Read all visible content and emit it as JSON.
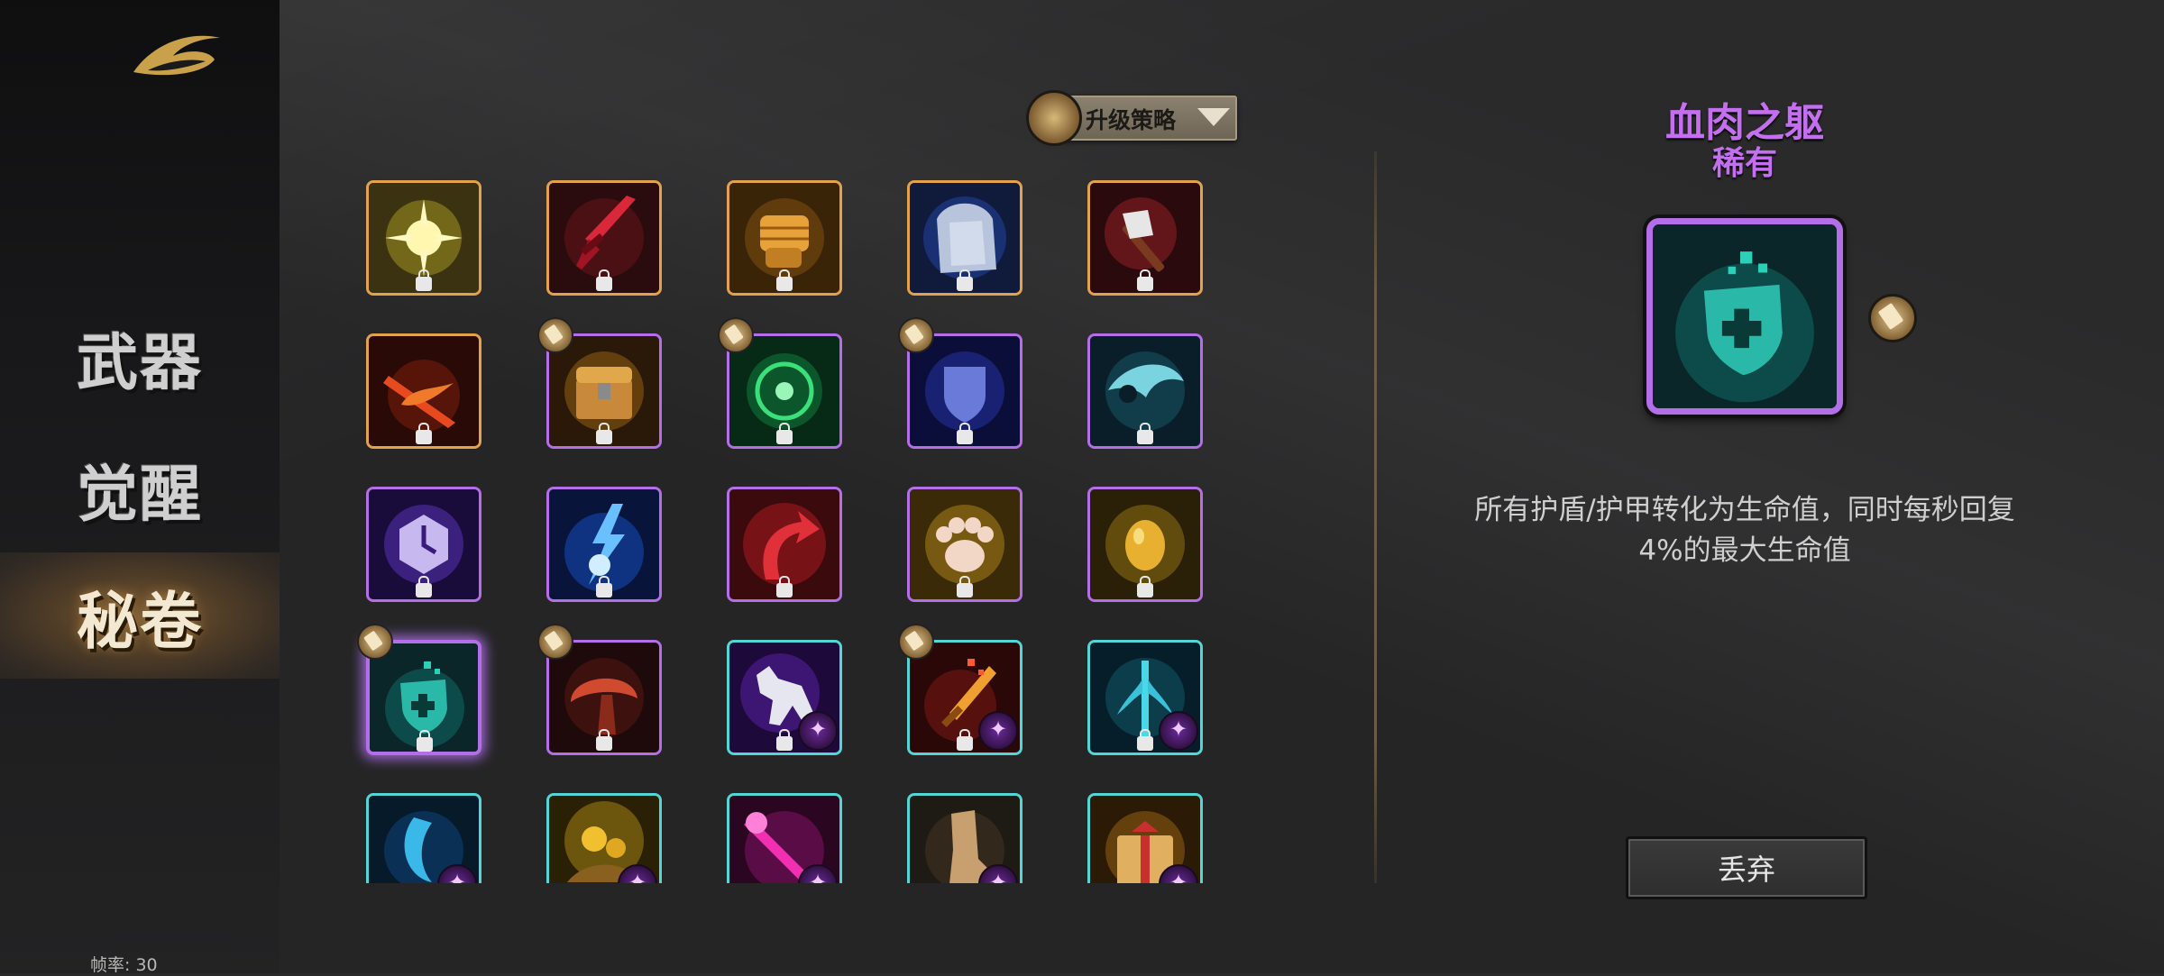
{
  "sidebar": {
    "logo_icon": "golden-swirl-logo-icon",
    "items": [
      {
        "label": "武器",
        "active": false
      },
      {
        "label": "觉醒",
        "active": false
      },
      {
        "label": "秘卷",
        "active": true
      }
    ],
    "fps_label": "帧率: 30"
  },
  "toolbar": {
    "strategy_label": "升级策略",
    "strategy_icon": "scroll-icon",
    "caret_icon": "caret-down-icon"
  },
  "grid": {
    "items": [
      {
        "icon": "light-burst-icon",
        "rarity": "orange",
        "scroll": false,
        "badge": false
      },
      {
        "icon": "blood-sword-icon",
        "rarity": "orange",
        "scroll": false,
        "badge": false
      },
      {
        "icon": "golden-fist-icon",
        "rarity": "orange",
        "scroll": false,
        "badge": false
      },
      {
        "icon": "stone-hand-icon",
        "rarity": "orange",
        "scroll": false,
        "badge": false
      },
      {
        "icon": "axe-icon",
        "rarity": "orange",
        "scroll": false,
        "badge": false
      },
      {
        "icon": "fire-slash-icon",
        "rarity": "orange",
        "scroll": false,
        "badge": false
      },
      {
        "icon": "treasure-chest-icon",
        "rarity": "purple",
        "scroll": true,
        "badge": false
      },
      {
        "icon": "green-orb-icon",
        "rarity": "purple",
        "scroll": true,
        "badge": false
      },
      {
        "icon": "blue-shield-icon",
        "rarity": "purple",
        "scroll": true,
        "badge": false
      },
      {
        "icon": "teal-fan-icon",
        "rarity": "purple",
        "scroll": false,
        "badge": false
      },
      {
        "icon": "stopwatch-icon",
        "rarity": "purple",
        "scroll": false,
        "badge": false
      },
      {
        "icon": "lightning-icon",
        "rarity": "purple",
        "scroll": false,
        "badge": false
      },
      {
        "icon": "red-arrow-icon",
        "rarity": "purple",
        "scroll": false,
        "badge": false
      },
      {
        "icon": "paw-icon",
        "rarity": "purple",
        "scroll": false,
        "badge": false
      },
      {
        "icon": "gold-egg-icon",
        "rarity": "purple",
        "scroll": false,
        "badge": false
      },
      {
        "icon": "heal-shield-icon",
        "rarity": "purple",
        "scroll": true,
        "badge": false,
        "selected": true
      },
      {
        "icon": "red-mushroom-icon",
        "rarity": "purple",
        "scroll": true,
        "badge": false
      },
      {
        "icon": "wolf-icon",
        "rarity": "cyan",
        "scroll": false,
        "badge": true
      },
      {
        "icon": "flame-sword-icon",
        "rarity": "cyan",
        "scroll": true,
        "badge": true
      },
      {
        "icon": "trident-icon",
        "rarity": "cyan",
        "scroll": false,
        "badge": true
      },
      {
        "icon": "blue-hook-icon",
        "rarity": "cyan",
        "scroll": false,
        "badge": true
      },
      {
        "icon": "gold-coins-icon",
        "rarity": "cyan",
        "scroll": false,
        "badge": true
      },
      {
        "icon": "pink-staff-icon",
        "rarity": "cyan",
        "scroll": false,
        "badge": true
      },
      {
        "icon": "boot-icon",
        "rarity": "cyan",
        "scroll": false,
        "badge": true
      },
      {
        "icon": "gift-box-icon",
        "rarity": "cyan",
        "scroll": false,
        "badge": true
      }
    ]
  },
  "detail": {
    "name": "血肉之躯",
    "rarity": "稀有",
    "icon": "heal-shield-icon",
    "description": "所有护盾/护甲转化为生命值，同时每秒回复4%的最大生命值",
    "discard_label": "丢弃"
  },
  "colors": {
    "orange_border": "#e3a24b",
    "purple_border": "#b46ee8",
    "cyan_border": "#54d6d6",
    "rare_text": "#c46ef0"
  }
}
